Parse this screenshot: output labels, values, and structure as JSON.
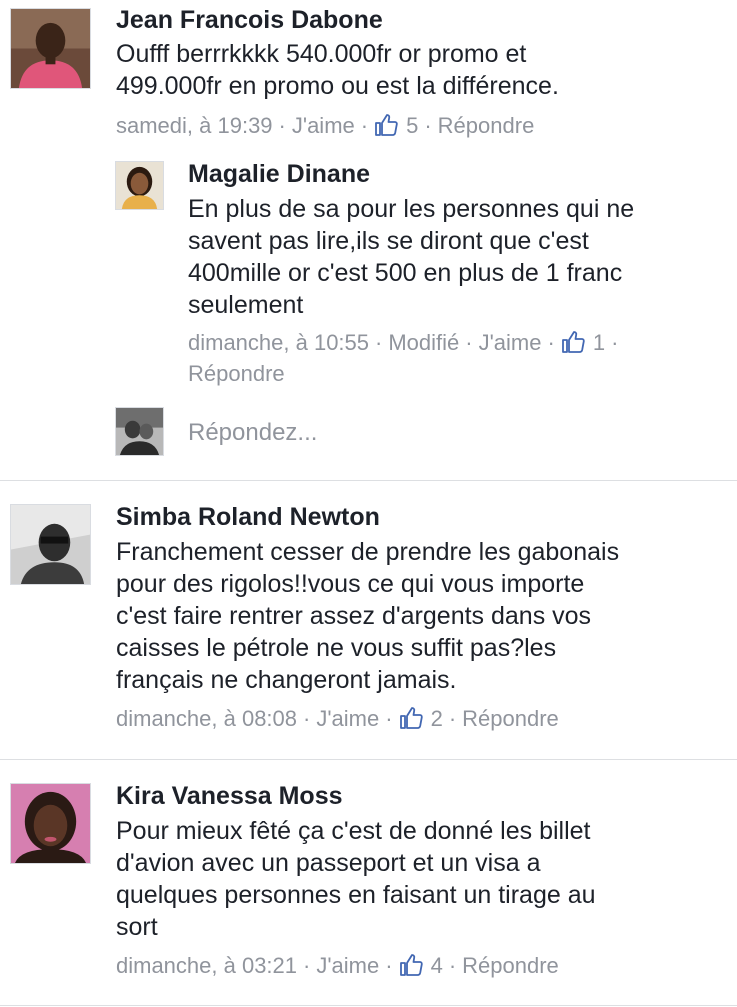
{
  "comments": [
    {
      "author": "Jean Francois Dabone",
      "text": "Oufff berrrkkkk 540.000fr or promo et\n499.000fr en promo ou est la différence.",
      "time": "samedi, à 19:39",
      "like_label": "J'aime",
      "likes": "5",
      "reply_label": "Répondre",
      "replies": [
        {
          "author": "Magalie Dinane",
          "text": "En plus de sa pour les personnes qui ne\nsavent pas lire,ils se diront que c'est\n400mille or c'est 500 en plus de 1 franc\nseulement",
          "time": "dimanche, à 10:55",
          "edited_label": "Modifié",
          "like_label": "J'aime",
          "likes": "1",
          "reply_label": "Répondre"
        }
      ],
      "reply_placeholder": "Répondez..."
    },
    {
      "author": "Simba Roland Newton",
      "text": "Franchement cesser de prendre les gabonais\npour des rigolos!!vous ce qui vous importe\nc'est faire rentrer assez d'argents dans vos\ncaisses le pétrole ne vous suffit pas?les\nfrançais ne changeront jamais.",
      "time": "dimanche, à 08:08",
      "like_label": "J'aime",
      "likes": "2",
      "reply_label": "Répondre"
    },
    {
      "author": "Kira Vanessa Moss",
      "text": "Pour mieux fêté ça c'est de donné les billet\nd'avion  avec un passeport et un visa a\nquelques personnes en faisant un tirage au\nsort",
      "time": "dimanche, à 03:21",
      "like_label": "J'aime",
      "likes": "4",
      "reply_label": "Répondre"
    }
  ],
  "colors": {
    "text": "#1d2129",
    "meta": "#90949c",
    "like_icon": "#4267b2",
    "divider": "#dddfe2"
  },
  "icons": {
    "like": "thumbs-up-icon"
  }
}
